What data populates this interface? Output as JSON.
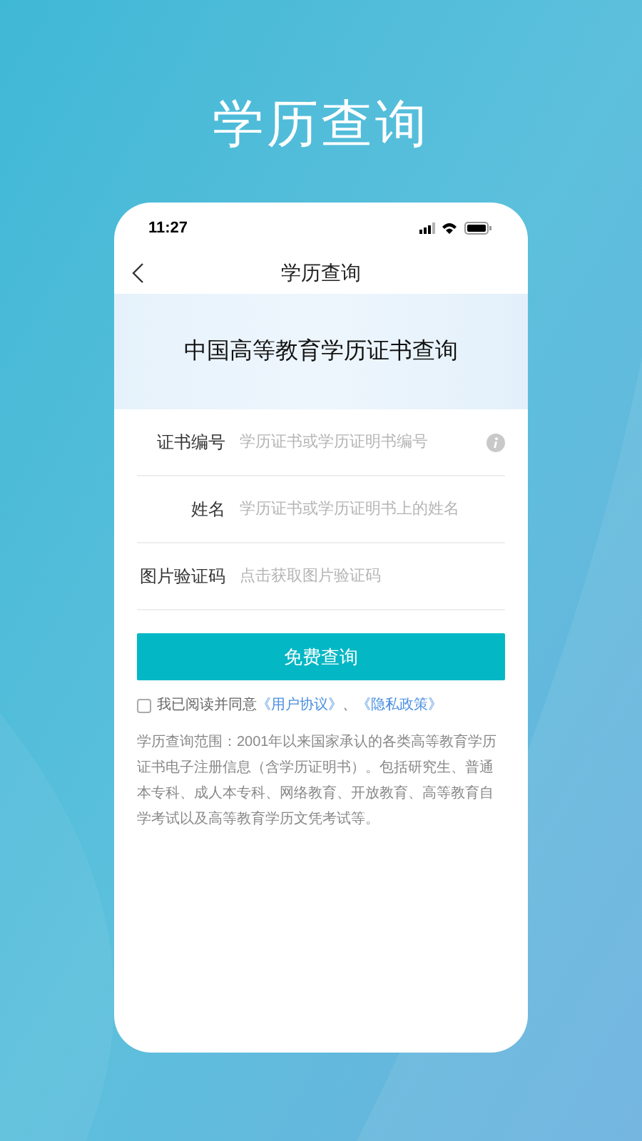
{
  "headline": "学历查询",
  "status_bar": {
    "time": "11:27"
  },
  "nav": {
    "title": "学历查询"
  },
  "banner": {
    "title": "中国高等教育学历证书查询"
  },
  "fields": [
    {
      "label": "证书编号",
      "placeholder": "学历证书或学历证明书编号",
      "info": true
    },
    {
      "label": "姓名",
      "placeholder": "学历证书或学历证明书上的姓名",
      "info": false
    },
    {
      "label": "图片验证码",
      "placeholder": "点击获取图片验证码",
      "info": false
    }
  ],
  "submit": {
    "label": "免费查询"
  },
  "consent": {
    "checked": false,
    "text": "我已阅读并同意",
    "links": [
      "《用户协议》",
      "《隐私政策》"
    ],
    "separator": "、"
  },
  "note": "学历查询范围：2001年以来国家承认的各类高等教育学历证书电子注册信息（含学历证明书）。包括研究生、普通本专科、成人本专科、网络教育、开放教育、高等教育自学考试以及高等教育学历文凭考试等。"
}
